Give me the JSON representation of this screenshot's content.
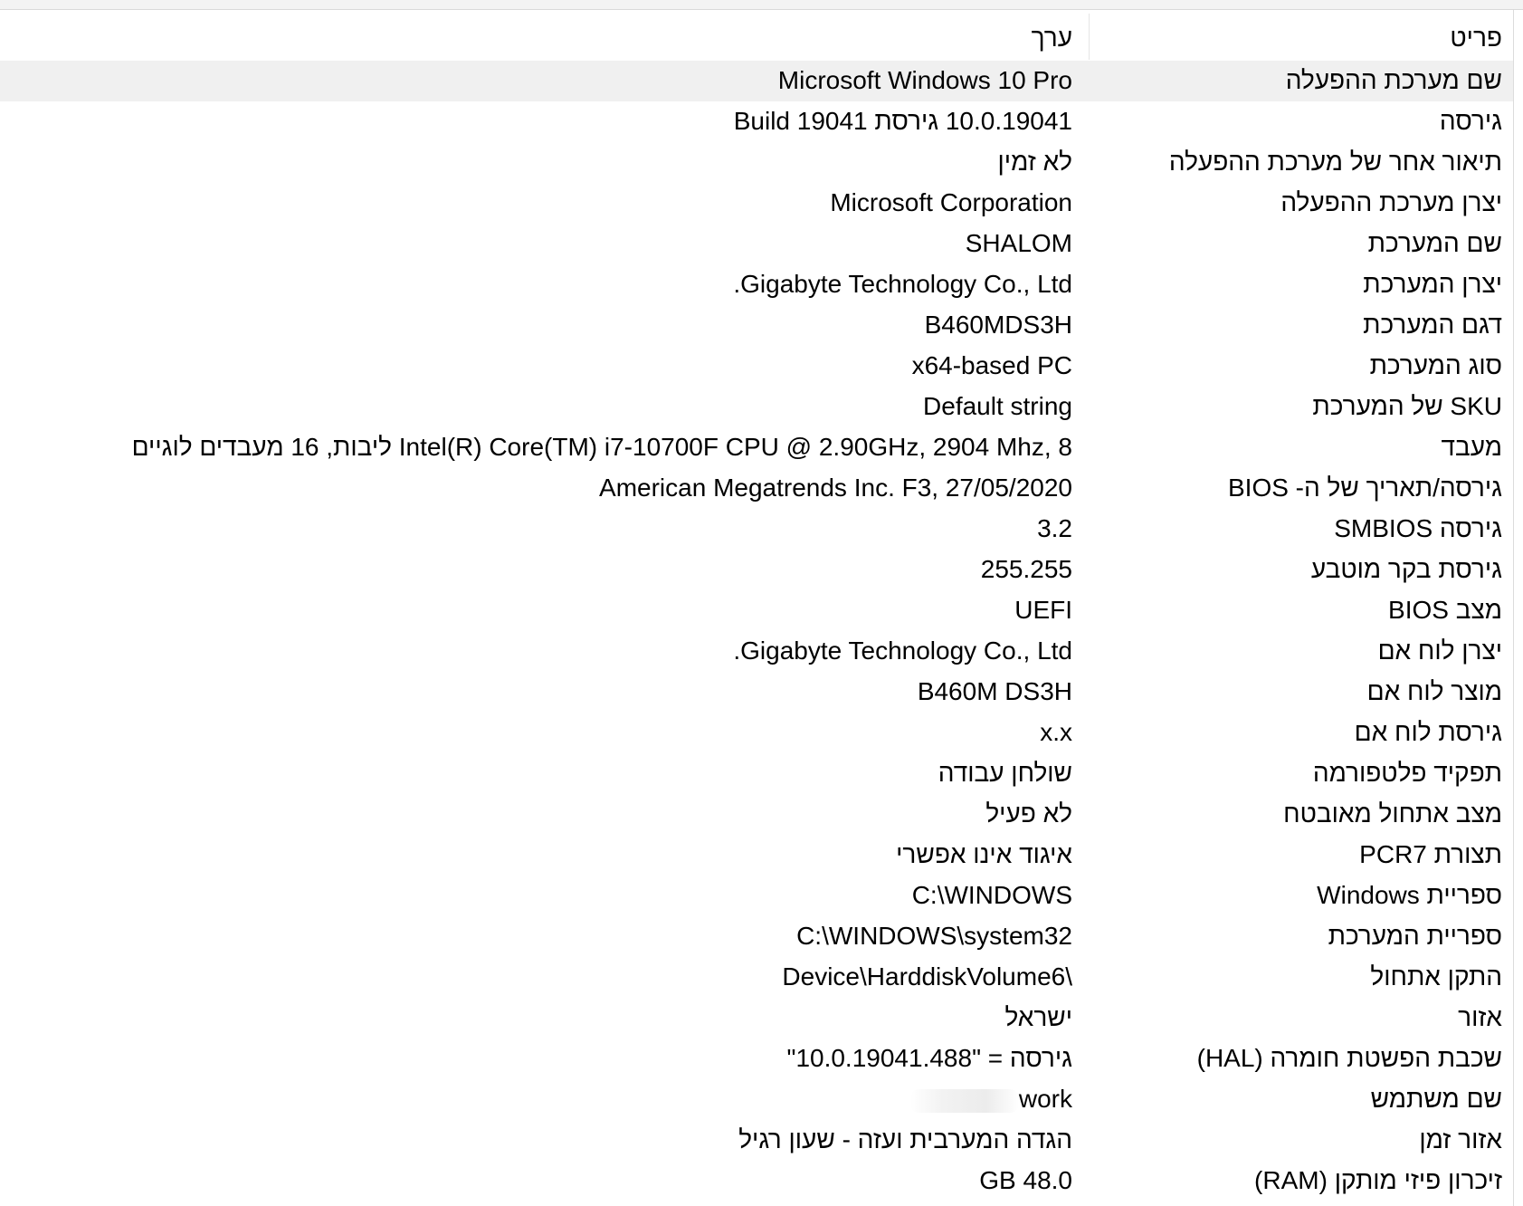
{
  "header": {
    "item_label": "פריט",
    "value_label": "ערך"
  },
  "rows": [
    {
      "item": "שם מערכת ההפעלה",
      "value": "Microsoft Windows 10 Pro"
    },
    {
      "item": "גירסה",
      "value": "10.0.19041 גירסת Build 19041"
    },
    {
      "item": "תיאור אחר של מערכת ההפעלה",
      "value": "לא זמין"
    },
    {
      "item": "יצרן מערכת ההפעלה",
      "value": "Microsoft Corporation"
    },
    {
      "item": "שם המערכת",
      "value": "SHALOM"
    },
    {
      "item": "יצרן המערכת",
      "value": "Gigabyte Technology Co., Ltd."
    },
    {
      "item": "דגם המערכת",
      "value": "B460MDS3H"
    },
    {
      "item": "סוג המערכת",
      "value": "x64-based PC"
    },
    {
      "item": "SKU של המערכת",
      "value": "Default string"
    },
    {
      "item": "מעבד",
      "value": "Intel(R) Core(TM) i7-10700F CPU @ 2.90GHz, 2904 Mhz, 8 ליבות, 16 מעבדים לוגיים"
    },
    {
      "item": "גירסה/תאריך של ה- BIOS",
      "value": "American Megatrends Inc. F3, 27/05/2020"
    },
    {
      "item": "גירסה SMBIOS",
      "value": "3.2"
    },
    {
      "item": "גירסת בקר מוטבע",
      "value": "255.255"
    },
    {
      "item": "מצב BIOS",
      "value": "UEFI"
    },
    {
      "item": "יצרן לוח אם",
      "value": "Gigabyte Technology Co., Ltd."
    },
    {
      "item": "מוצר לוח אם",
      "value": "B460M DS3H"
    },
    {
      "item": "גירסת לוח אם",
      "value": "x.x"
    },
    {
      "item": "תפקיד פלטפורמה",
      "value": "שולחן עבודה"
    },
    {
      "item": "מצב אתחול מאובטח",
      "value": "לא פעיל"
    },
    {
      "item": "תצורת PCR7",
      "value": "איגוד אינו אפשרי"
    },
    {
      "item": "ספריית Windows",
      "value": "C:\\WINDOWS"
    },
    {
      "item": "ספריית המערכת",
      "value": "C:\\WINDOWS\\system32"
    },
    {
      "item": "התקן אתחול",
      "value": "\\Device\\HarddiskVolume6"
    },
    {
      "item": "אזור",
      "value": "ישראל"
    },
    {
      "item": "שכבת הפשטת חומרה (HAL)",
      "value": "גירסה = \"10.0.19041.488\""
    },
    {
      "item": "שם משתמש",
      "value": "work"
    },
    {
      "item": "אזור זמן",
      "value": "הגדה המערבית ועזה - שעון רגיל"
    },
    {
      "item": "זיכרון פיזי מותקן (RAM)",
      "value": "48.0 GB"
    }
  ]
}
